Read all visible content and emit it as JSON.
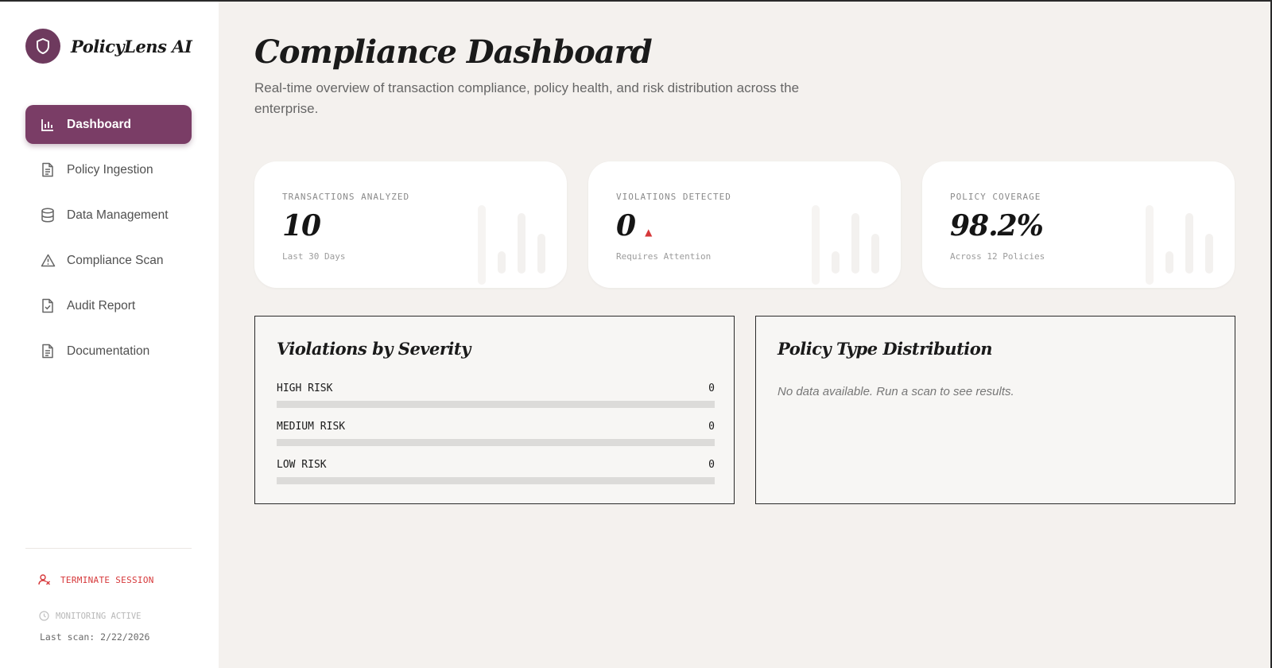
{
  "brand": {
    "name": "PolicyLens AI"
  },
  "sidebar": {
    "items": [
      {
        "label": "Dashboard",
        "icon": "bar-chart-icon",
        "active": true
      },
      {
        "label": "Policy Ingestion",
        "icon": "document-icon"
      },
      {
        "label": "Data Management",
        "icon": "database-icon"
      },
      {
        "label": "Compliance Scan",
        "icon": "warning-icon"
      },
      {
        "label": "Audit Report",
        "icon": "file-check-icon"
      },
      {
        "label": "Documentation",
        "icon": "document-icon"
      }
    ],
    "terminate_label": "TERMINATE SESSION",
    "monitoring_label": "MONITORING ACTIVE",
    "last_scan": "Last scan: 2/22/2026"
  },
  "header": {
    "title": "Compliance Dashboard",
    "subtitle": "Real-time overview of transaction compliance, policy health, and risk distribution across the enterprise."
  },
  "stats": [
    {
      "label": "TRANSACTIONS ANALYZED",
      "value": "10",
      "caption": "Last 30 Days"
    },
    {
      "label": "VIOLATIONS DETECTED",
      "value": "0",
      "caption": "Requires Attention",
      "indicator": "▲"
    },
    {
      "label": "POLICY COVERAGE",
      "value": "98.2%",
      "caption": "Across 12 Policies"
    }
  ],
  "severity": {
    "title": "Violations by Severity",
    "rows": [
      {
        "label": "HIGH RISK",
        "count": "0",
        "fraction": 0
      },
      {
        "label": "MEDIUM RISK",
        "count": "0",
        "fraction": 0
      },
      {
        "label": "LOW RISK",
        "count": "0",
        "fraction": 0
      }
    ]
  },
  "distribution": {
    "title": "Policy Type Distribution",
    "empty_text": "No data available. Run a scan to see results."
  },
  "colors": {
    "accent": "#7a3d66",
    "danger": "#d6383a",
    "background": "#f4f1ee"
  }
}
